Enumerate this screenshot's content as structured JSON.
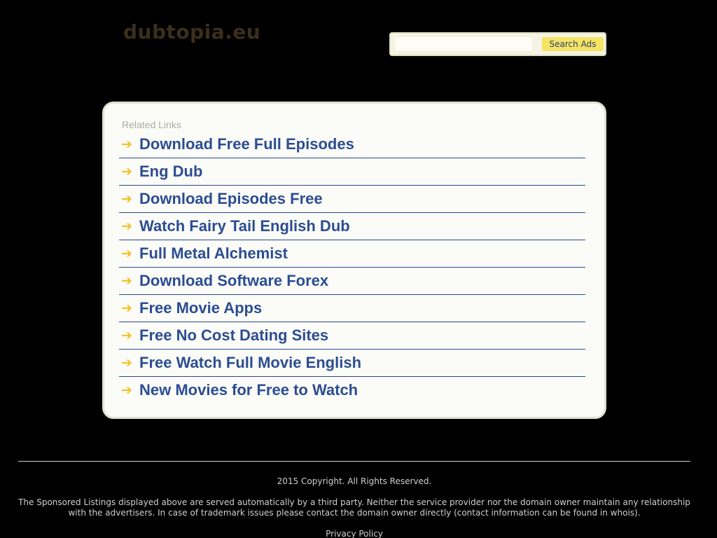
{
  "header": {
    "site_title": "dubtopia.eu",
    "search": {
      "value": "",
      "button_label": "Search Ads"
    }
  },
  "related_links": {
    "heading": "Related Links",
    "arrow_glyph": "➔",
    "items": [
      {
        "label": "Download Free Full Episodes"
      },
      {
        "label": "Eng Dub"
      },
      {
        "label": "Download Episodes Free"
      },
      {
        "label": "Watch Fairy Tail English Dub"
      },
      {
        "label": "Full Metal Alchemist"
      },
      {
        "label": "Download Software Forex"
      },
      {
        "label": "Free Movie Apps"
      },
      {
        "label": "Free No Cost Dating Sites"
      },
      {
        "label": "Free Watch Full Movie English"
      },
      {
        "label": "New Movies for Free to Watch"
      }
    ]
  },
  "footer": {
    "copyright": "2015 Copyright. All Rights Reserved.",
    "disclaimer": "The Sponsored Listings displayed above are served automatically by a third party. Neither the service provider nor the domain owner maintain any relationship with the advertisers. In case of trademark issues please contact the domain owner directly (contact information can be found in whois).",
    "privacy_label": "Privacy Policy"
  },
  "colors": {
    "background": "#000000",
    "site_title": "#3b2f1c",
    "link": "#2c4d93",
    "arrow": "#f1c32a",
    "button": "#f5e364",
    "panel": "#fbfcf7"
  }
}
